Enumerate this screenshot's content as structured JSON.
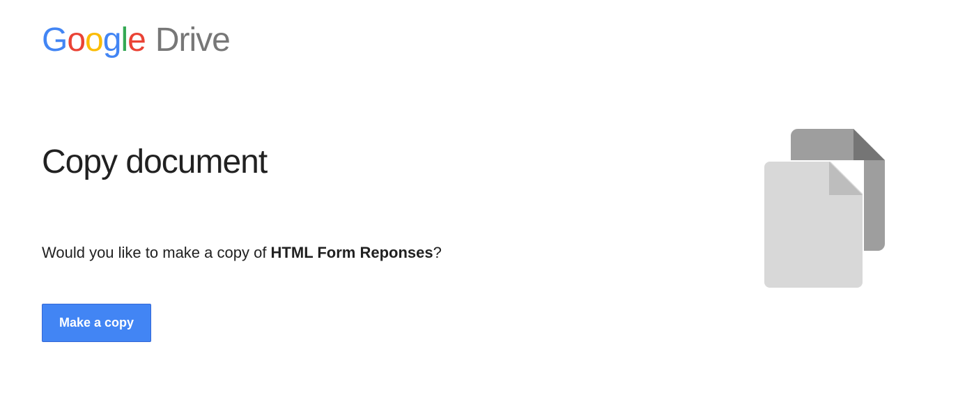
{
  "logo": {
    "brand": "Google",
    "product": "Drive"
  },
  "page": {
    "title": "Copy document",
    "prompt_prefix": "Would you like to make a copy of ",
    "document_name": "HTML Form Reponses",
    "prompt_suffix": "?"
  },
  "actions": {
    "make_copy_label": "Make a copy"
  }
}
